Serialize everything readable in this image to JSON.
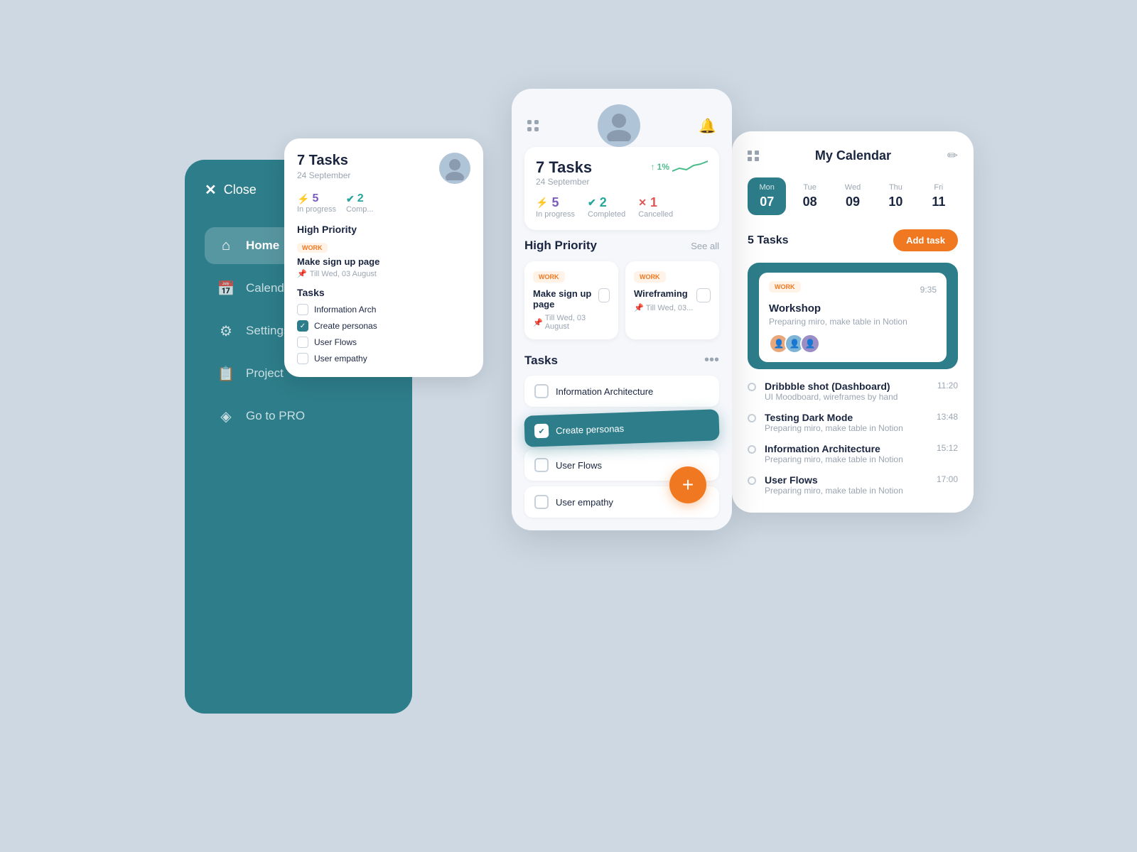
{
  "background": "#cdd8e3",
  "sidebar": {
    "close_label": "Close",
    "nav_items": [
      {
        "icon": "home",
        "label": "Home",
        "active": true
      },
      {
        "icon": "calendar",
        "label": "Calendar",
        "active": false
      },
      {
        "icon": "settings",
        "label": "Settings",
        "active": false
      },
      {
        "icon": "project",
        "label": "Project",
        "active": false
      },
      {
        "icon": "diamond",
        "label": "Go to PRO",
        "active": false
      }
    ]
  },
  "mini_card": {
    "task_count": "7 Tasks",
    "date": "24 September",
    "stats": {
      "in_progress_val": "5",
      "in_progress_label": "In progress",
      "completed_val": "2",
      "completed_label": "Comp..."
    },
    "high_priority_label": "High Priority",
    "work_badge": "WORK",
    "task_name": "Make sign up page",
    "task_due": "Till Wed, 03 August",
    "tasks_label": "Tasks",
    "task_list": [
      {
        "label": "Information Arch",
        "checked": false
      },
      {
        "label": "Create personas",
        "checked": true
      },
      {
        "label": "User Flows",
        "checked": false
      },
      {
        "label": "User empathy",
        "checked": false
      }
    ]
  },
  "main_card": {
    "task_count": "7 Tasks",
    "task_date": "24 September",
    "trend_pct": "↑ 1%",
    "stats": [
      {
        "val": "5",
        "label": "In progress",
        "color": "purple"
      },
      {
        "val": "2",
        "label": "Completed",
        "color": "teal"
      },
      {
        "val": "1",
        "label": "Cancelled",
        "color": "red"
      }
    ],
    "high_priority_label": "High Priority",
    "see_all_label": "See all",
    "hp_cards": [
      {
        "badge": "WORK",
        "title": "Make sign up page",
        "due": "Till Wed, 03 August"
      },
      {
        "badge": "WORK",
        "title": "Wireframing",
        "due": "Till Wed, 03..."
      }
    ],
    "tasks_label": "Tasks",
    "tasks": [
      {
        "label": "Information Architecture",
        "checked": false
      },
      {
        "label": "Create personas",
        "checked": true,
        "highlighted": true
      },
      {
        "label": "User Flows",
        "checked": false
      },
      {
        "label": "User empathy",
        "checked": false
      }
    ],
    "fab_label": "+"
  },
  "calendar": {
    "title": "My Calendar",
    "days": [
      {
        "name": "Mon",
        "num": "07",
        "active": true
      },
      {
        "name": "Tue",
        "num": "08",
        "active": false
      },
      {
        "name": "Wed",
        "num": "09",
        "active": false
      },
      {
        "name": "Thu",
        "num": "10",
        "active": false
      },
      {
        "name": "Fri",
        "num": "11",
        "active": false
      }
    ],
    "tasks_count": "5 Tasks",
    "add_task_label": "Add task",
    "workshop": {
      "badge": "WORK",
      "time": "9:35",
      "title": "Workshop",
      "subtitle": "Preparing miro, make table in Notion"
    },
    "schedule": [
      {
        "title": "Dribbble shot (Dashboard)",
        "time": "11:20",
        "subtitle": "UI Moodboard, wireframes by hand"
      },
      {
        "title": "Testing Dark Mode",
        "time": "13:48",
        "subtitle": "Preparing miro, make table in Notion"
      },
      {
        "title": "Information Architecture",
        "time": "15:12",
        "subtitle": "Preparing miro, make table in Notion"
      },
      {
        "title": "User Flows",
        "time": "17:00",
        "subtitle": "Preparing miro, make table in Notion"
      }
    ]
  }
}
